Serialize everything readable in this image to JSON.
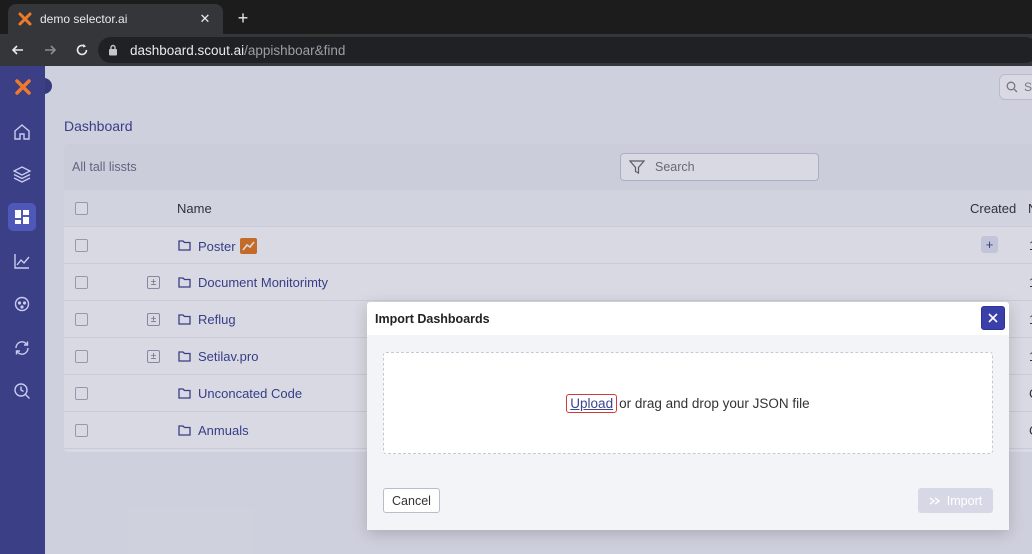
{
  "browser": {
    "tab_title": "demo selector.ai",
    "tab_close": "✕",
    "new_tab": "+",
    "url_host": "dashboard.scout.ai",
    "url_path": "/appishboar&find"
  },
  "sidebar": {
    "items": [
      {
        "name": "home",
        "icon": "home-icon"
      },
      {
        "name": "layers",
        "icon": "layers-icon"
      },
      {
        "name": "dashboards",
        "icon": "dashboard-grid-icon",
        "active": true
      },
      {
        "name": "analytics",
        "icon": "line-chart-icon"
      },
      {
        "name": "integrations",
        "icon": "gear-network-icon"
      },
      {
        "name": "sync",
        "icon": "refresh-icon"
      },
      {
        "name": "monitoring",
        "icon": "clock-search-icon"
      }
    ]
  },
  "header": {
    "top_search_placeholder": "S"
  },
  "breadcrumb": "Dashboard",
  "list": {
    "heading": "All tall lissts",
    "search_placeholder": "Search",
    "columns": {
      "name": "Name",
      "created": "Created",
      "trailing": "N"
    },
    "rows": [
      {
        "name": "Poster",
        "expandable": false,
        "has_badge": true,
        "trailing": "1"
      },
      {
        "name": "Document Monitorimty",
        "expandable": true,
        "trailing": "1"
      },
      {
        "name": "Reflug",
        "expandable": true,
        "trailing": "1"
      },
      {
        "name": "Setilav.pro",
        "expandable": true,
        "trailing": "1"
      },
      {
        "name": "Unconcated Code",
        "expandable": false,
        "trailing": "C"
      },
      {
        "name": "Anmuals",
        "expandable": false,
        "trailing": "C"
      }
    ],
    "add_label": "+"
  },
  "modal": {
    "title": "Import Dashboards",
    "upload_link": "Upload",
    "dropzone_text": " or drag and drop your JSON file",
    "cancel_label": "Cancel",
    "import_label": "Import"
  },
  "colors": {
    "sidebar": "#3a3f86",
    "accent": "#3a40a8",
    "link": "#3c4390",
    "highlight": "#d23a3a"
  }
}
